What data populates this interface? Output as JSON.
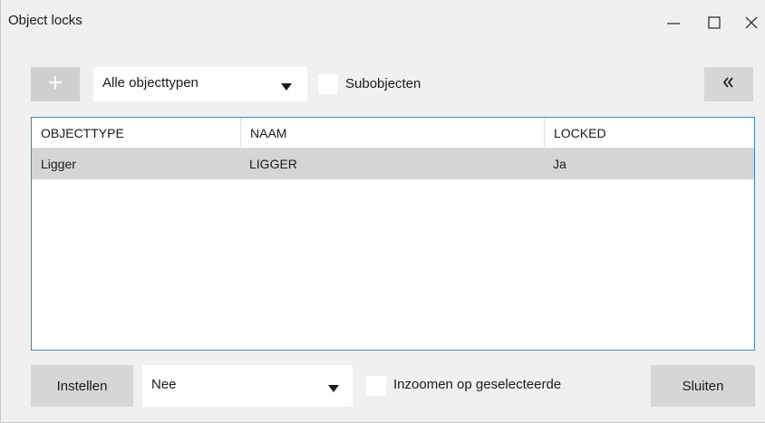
{
  "window": {
    "title": "Object locks",
    "controls": [
      "minimize-icon",
      "maximize-icon",
      "close-icon"
    ]
  },
  "toolbar": {
    "add_icon": "plus-icon",
    "object_type_select": {
      "value": "Alle objecttypen"
    },
    "subobjects_checkbox": {
      "label": "Subobjecten",
      "checked": false
    },
    "collapse_icon": "double-chevron-left-icon"
  },
  "table": {
    "columns": [
      "OBJECTTYPE",
      "NAAM",
      "LOCKED"
    ],
    "rows": [
      {
        "objecttype": "Ligger",
        "naam": "LIGGER",
        "locked": "Ja",
        "selected": true
      }
    ]
  },
  "footer": {
    "apply_label": "Instellen",
    "mode_select": {
      "value": "Nee"
    },
    "zoom_checkbox": {
      "label": "Inzoomen op geselecteerde",
      "checked": false
    },
    "close_label": "Sluiten"
  },
  "colors": {
    "window_bg": "#f0f0f0",
    "grid_border": "#3f87c6",
    "selected_row": "#d5d5d5",
    "button_bg": "#d6d6d6",
    "disabled_button_bg": "#cfcfcf"
  }
}
